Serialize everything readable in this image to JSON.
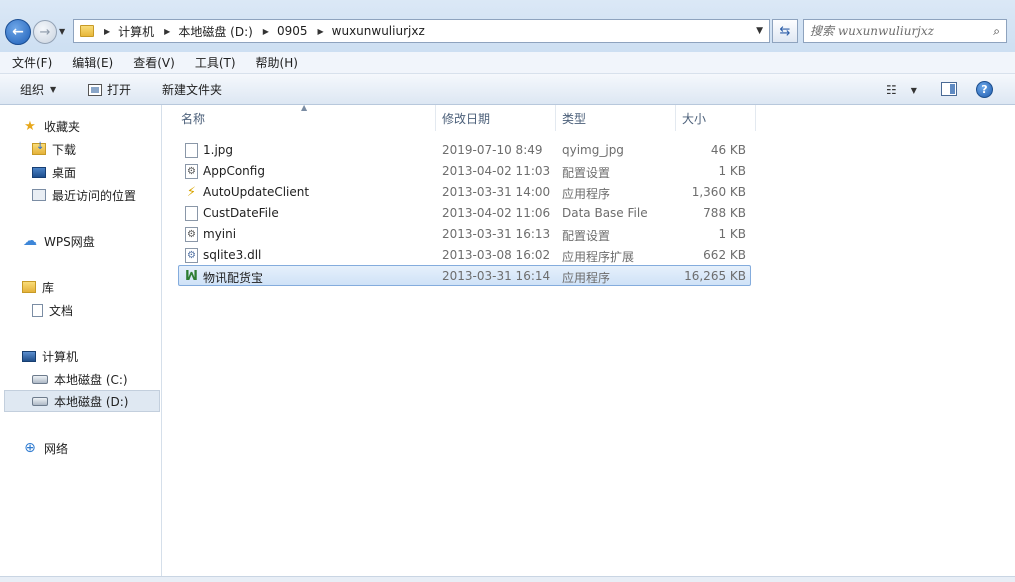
{
  "address": {
    "crumbs": [
      "计算机",
      "本地磁盘 (D:)",
      "0905",
      "wuxunwuliurjxz"
    ]
  },
  "search": {
    "placeholder": "搜索 wuxunwuliurjxz"
  },
  "menubar": {
    "items": [
      "文件(F)",
      "编辑(E)",
      "查看(V)",
      "工具(T)",
      "帮助(H)"
    ]
  },
  "commands": {
    "organize": "组织",
    "open": "打开",
    "new_folder": "新建文件夹"
  },
  "nav": {
    "favorites": "收藏夹",
    "downloads": "下载",
    "desktop": "桌面",
    "recent": "最近访问的位置",
    "wps": "WPS网盘",
    "libraries": "库",
    "documents": "文档",
    "computer": "计算机",
    "drive_c": "本地磁盘 (C:)",
    "drive_d": "本地磁盘 (D:)",
    "network": "网络"
  },
  "columns": {
    "name": "名称",
    "date": "修改日期",
    "type": "类型",
    "size": "大小"
  },
  "files": [
    {
      "name": "1.jpg",
      "date": "2019-07-10 8:49",
      "type": "qyimg_jpg",
      "size": "46 KB",
      "icon": "image-file-icon"
    },
    {
      "name": "AppConfig",
      "date": "2013-04-02 11:03",
      "type": "配置设置",
      "size": "1 KB",
      "icon": "config-file-icon"
    },
    {
      "name": "AutoUpdateClient",
      "date": "2013-03-31 14:00",
      "type": "应用程序",
      "size": "1,360 KB",
      "icon": "update-app-icon"
    },
    {
      "name": "CustDateFile",
      "date": "2013-04-02 11:06",
      "type": "Data Base File",
      "size": "788 KB",
      "icon": "database-file-icon"
    },
    {
      "name": "myini",
      "date": "2013-03-31 16:13",
      "type": "配置设置",
      "size": "1 KB",
      "icon": "config-file-icon"
    },
    {
      "name": "sqlite3.dll",
      "date": "2013-03-08 16:02",
      "type": "应用程序扩展",
      "size": "662 KB",
      "icon": "dll-file-icon"
    },
    {
      "name": "物讯配货宝",
      "date": "2013-03-31 16:14",
      "type": "应用程序",
      "size": "16,265 KB",
      "icon": "app-logo-icon"
    }
  ],
  "selected_file_index": 6
}
